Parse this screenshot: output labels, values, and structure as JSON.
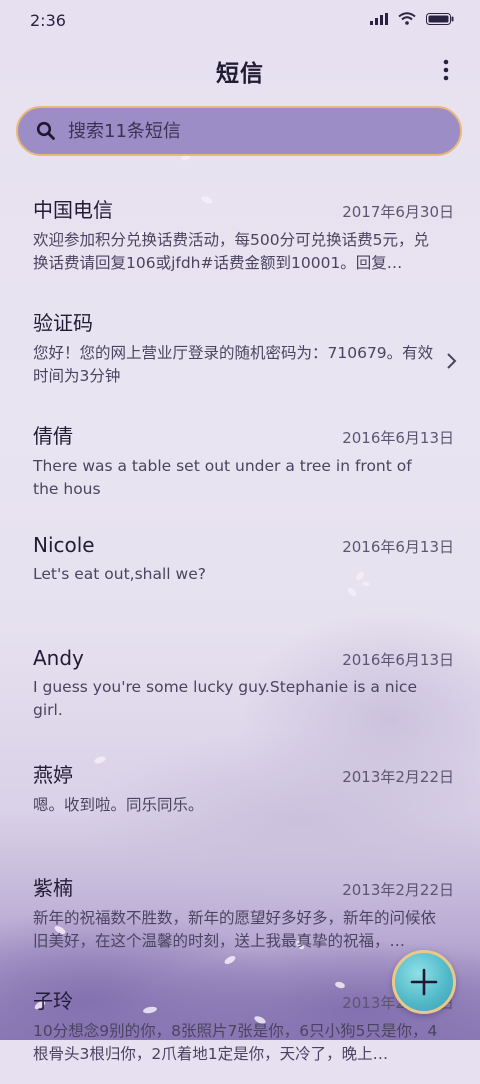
{
  "status_bar": {
    "time": "2:36",
    "icons": [
      "signal-icon",
      "wifi-icon",
      "battery-icon"
    ]
  },
  "header": {
    "title": "短信",
    "more_icon": "more-vertical-icon"
  },
  "search": {
    "placeholder": "搜索11条短信",
    "icon": "search-icon"
  },
  "messages": [
    {
      "name": "中国电信",
      "date": "2017年6月30日",
      "preview": "欢迎参加积分兑换话费活动，每500分可兑换话费5元，兑换话费请回复106或jfdh#话费金额到10001。回复…"
    },
    {
      "name": "验证码",
      "date": "",
      "preview": "您好！您的网上营业厅登录的随机密码为：710679。有效时间为3分钟",
      "chevron": true
    },
    {
      "name": "倩倩",
      "date": "2016年6月13日",
      "preview": "There was a table set out under a tree in front of the hous"
    },
    {
      "name": "Nicole",
      "date": "2016年6月13日",
      "preview": "Let's eat out,shall we?"
    },
    {
      "name": "Andy",
      "date": "2016年6月13日",
      "preview": "I guess you're some lucky guy.Stephanie is a nice girl."
    },
    {
      "name": "燕婷",
      "date": "2013年2月22日",
      "preview": "嗯。收到啦。同乐同乐。"
    },
    {
      "name": "紫楠",
      "date": "2013年2月22日",
      "preview": "新年的祝福数不胜数，新年的愿望好多好多，新年的问候依旧美好，在这个温馨的时刻，送上我最真挚的祝福，…"
    },
    {
      "name": "子玲",
      "date": "2013年2月22日",
      "preview": "10分想念9别的你，8张照片7张是你，6只小狗5只是你，4根骨头3根归你，2爪着地1定是你，天冷了，晚上…"
    }
  ],
  "fab": {
    "icon": "plus-icon"
  },
  "colors": {
    "search_bg": "#9d8dc7",
    "search_border": "#e8b876",
    "fab": "#4fb7c7"
  }
}
